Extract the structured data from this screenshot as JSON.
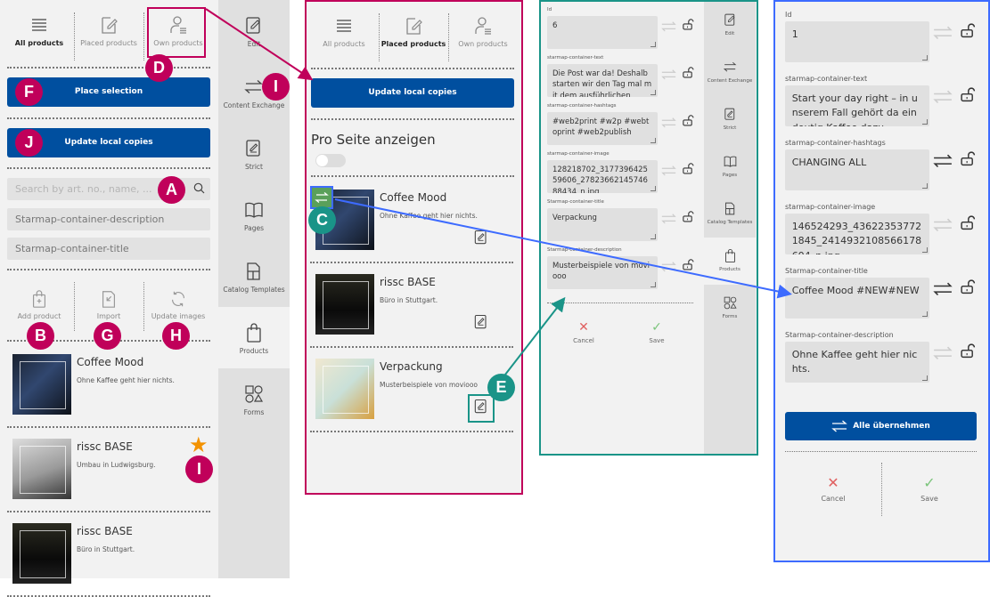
{
  "colors": {
    "brand_blue": "#004f9f",
    "annotation_magenta": "#c0005a",
    "annotation_teal": "#1a9488",
    "annotation_blue": "#3d6bff",
    "star": "#f39200"
  },
  "rail": [
    {
      "label": "Edit",
      "icon": "edit-icon"
    },
    {
      "label": "Content Exchange",
      "icon": "exchange-icon"
    },
    {
      "label": "Strict",
      "icon": "strict-icon"
    },
    {
      "label": "Pages",
      "icon": "book-icon"
    },
    {
      "label": "Catalog Templates",
      "icon": "template-icon"
    },
    {
      "label": "Products",
      "icon": "bag-icon",
      "active": true
    },
    {
      "label": "Forms",
      "icon": "shapes-icon"
    }
  ],
  "panel1": {
    "tabs": [
      {
        "label": "All products",
        "icon": "list-icon"
      },
      {
        "label": "Placed products",
        "icon": "placed-icon"
      },
      {
        "label": "Own products",
        "icon": "user-list-icon"
      }
    ],
    "place_selection": "Place selection",
    "update_local_copies": "Update local copies",
    "search_placeholder": "Search by art. no., name, ...",
    "filters": [
      "Starmap-container-description",
      "Starmap-container-title"
    ],
    "actions": [
      {
        "label": "Add product",
        "icon": "bag-plus-icon"
      },
      {
        "label": "Import",
        "icon": "import-icon"
      },
      {
        "label": "Update images",
        "icon": "refresh-icon"
      }
    ],
    "products": [
      {
        "title": "Coffee Mood",
        "desc": "Ohne Kaffee geht hier nichts.",
        "thumb": "dark"
      },
      {
        "title": "rissc BASE",
        "desc": "Umbau in Ludwigsburg.",
        "thumb": "light",
        "starred": true
      },
      {
        "title": "rissc BASE",
        "desc": "Büro in Stuttgart.",
        "thumb": "night"
      }
    ]
  },
  "panel2": {
    "tabs": [
      {
        "label": "All products",
        "icon": "list-icon"
      },
      {
        "label": "Placed products",
        "icon": "placed-icon",
        "active": true
      },
      {
        "label": "Own products",
        "icon": "user-list-icon"
      }
    ],
    "update_local_copies": "Update local copies",
    "per_page_label": "Pro Seite anzeigen",
    "per_page_toggle": false,
    "products": [
      {
        "title": "Coffee Mood",
        "desc": "Ohne Kaffee geht hier nichts.",
        "thumb": "dark"
      },
      {
        "title": "rissc BASE",
        "desc": "Büro in Stuttgart.",
        "thumb": "night"
      },
      {
        "title": "Verpackung",
        "desc": "Musterbeispiele von moviooo",
        "thumb": "pack"
      }
    ]
  },
  "panel3": {
    "fields": [
      {
        "label": "Id",
        "value": "6"
      },
      {
        "label": "starmap-container-text",
        "value": "Die Post war da! Deshalb starten wir den Tag mal mit dem ausführlichen"
      },
      {
        "label": "starmap-container-hashtags",
        "value": "#web2print #w2p #webtoprint #web2publish"
      },
      {
        "label": "starmap-container-image",
        "value": "128218702_317739642559606_2782366214574688434_n.jpg"
      },
      {
        "label": "Starmap-container-title",
        "value": "Verpackung"
      },
      {
        "label": "Starmap-container-description",
        "value": "Musterbeispiele von moviooo"
      }
    ],
    "cancel": "Cancel",
    "save": "Save"
  },
  "panel4": {
    "fields": [
      {
        "label": "Id",
        "value": "1",
        "changed": false
      },
      {
        "label": "starmap-container-text",
        "value": "Start your day right – in unserem Fall gehört da eindeutig Kaffee dazu",
        "changed": false
      },
      {
        "label": "starmap-container-hashtags",
        "value": "CHANGING ALL",
        "changed": true
      },
      {
        "label": "starmap-container-image",
        "value": "146524293_436223537721845_2414932108566178604_n.jpg",
        "changed": false
      },
      {
        "label": "Starmap-container-title",
        "value": "Coffee Mood #NEW#NEW",
        "changed": true
      },
      {
        "label": "Starmap-container-description",
        "value": "Ohne Kaffee geht hier nichts.",
        "changed": false
      }
    ],
    "apply_all": "Alle übernehmen",
    "cancel": "Cancel",
    "save": "Save"
  },
  "annotations": [
    "A",
    "B",
    "C",
    "D",
    "E",
    "F",
    "G",
    "H",
    "I",
    "I",
    "J"
  ]
}
